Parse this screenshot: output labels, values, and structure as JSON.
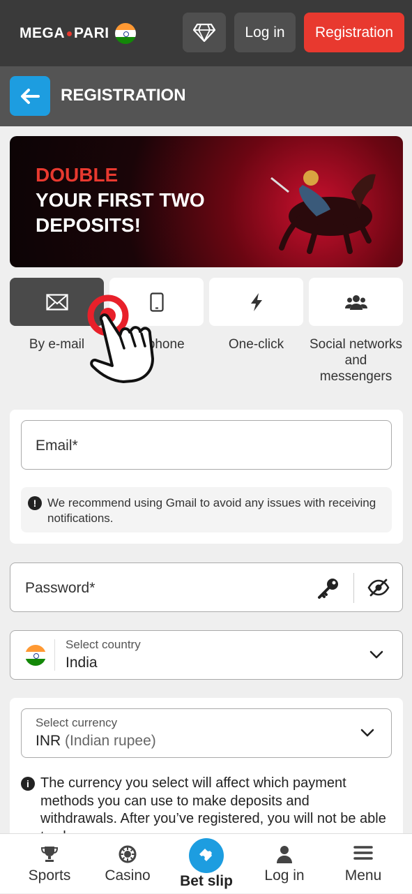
{
  "header": {
    "logo_left": "MEGA",
    "logo_right": "PARI",
    "login_label": "Log in",
    "registration_label": "Registration",
    "icons": {
      "diamond": "diamond-icon",
      "flag": "india-flag-icon"
    }
  },
  "subheader": {
    "title": "REGISTRATION",
    "back_icon": "arrow-left-icon"
  },
  "banner": {
    "line1": "DOUBLE",
    "line2": "YOUR FIRST TWO",
    "line3": "DEPOSITS!"
  },
  "tabs": [
    {
      "label": "By e-mail",
      "icon": "envelope-icon",
      "active": true
    },
    {
      "label": "By phone",
      "icon": "phone-icon",
      "active": false
    },
    {
      "label": "One-click",
      "icon": "lightning-icon",
      "active": false
    },
    {
      "label": "Social networks and messengers",
      "icon": "users-icon",
      "active": false
    }
  ],
  "email": {
    "label": "Email*",
    "notice": "We recommend using Gmail to avoid any issues with receiving notifications."
  },
  "password": {
    "label": "Password*",
    "icons": [
      "key-icon",
      "eye-slash-icon"
    ]
  },
  "country": {
    "label": "Select country",
    "value": "India"
  },
  "currency": {
    "label": "Select currency",
    "code": "INR",
    "name": "(Indian rupee)",
    "notice": "The currency you select will affect which payment methods you can use to make deposits and withdrawals. After you’ve registered, you will not be able to change your currency."
  },
  "bottom_nav": [
    {
      "label": "Sports",
      "icon": "trophy-icon"
    },
    {
      "label": "Casino",
      "icon": "casino-chip-icon"
    },
    {
      "label": "Bet slip",
      "icon": "ticket-icon"
    },
    {
      "label": "Log in",
      "icon": "user-icon"
    },
    {
      "label": "Menu",
      "icon": "hamburger-icon"
    }
  ],
  "colors": {
    "accent_red": "#e8392f",
    "accent_blue": "#1d9de0",
    "header_bg": "#3a3a3a",
    "subheader_bg": "#545454"
  }
}
